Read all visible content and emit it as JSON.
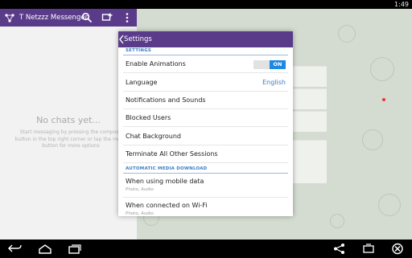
{
  "status_bar": {
    "time": "1:49"
  },
  "app": {
    "title": "T Netzzz Messenger",
    "icons": [
      "app-logo-icon",
      "search-icon",
      "compose-icon",
      "overflow-menu-icon"
    ]
  },
  "chat_list": {
    "empty_title": "No chats yet...",
    "empty_hint": "Start messaging by pressing the compose button in the top right corner or tap the menu button for more options"
  },
  "settings": {
    "title": "Settings",
    "section_settings": "SETTINGS",
    "enable_animations": {
      "label": "Enable Animations",
      "toggle_label": "ON",
      "toggle_color": "#1e88e5"
    },
    "language": {
      "label": "Language",
      "value": "English"
    },
    "notifications": {
      "label": "Notifications and Sounds"
    },
    "blocked_users": {
      "label": "Blocked Users"
    },
    "chat_background": {
      "label": "Chat Background"
    },
    "terminate_sessions": {
      "label": "Terminate All Other Sessions"
    },
    "section_media": "AUTOMATIC MEDIA DOWNLOAD",
    "mobile_data": {
      "label": "When using mobile data",
      "sub": "Photo, Audio"
    },
    "wifi": {
      "label": "When connected on Wi-Fi",
      "sub": "Photo, Audio"
    }
  },
  "colors": {
    "header": "#5a3b8a",
    "accent": "#3d7dc3"
  },
  "nav_bar": {
    "icons": [
      "back-icon",
      "home-icon",
      "recent-apps-icon",
      "share-icon",
      "rotate-icon",
      "close-icon"
    ]
  }
}
